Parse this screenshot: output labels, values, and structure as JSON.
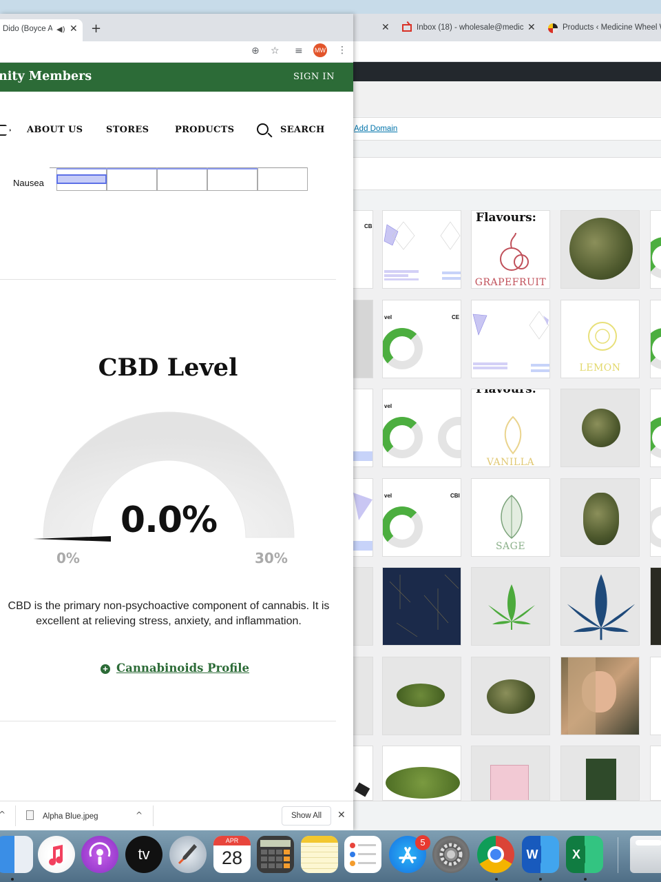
{
  "front_window": {
    "tab": {
      "title": "Dido (Boyce A",
      "speaker_glyph": "◀)",
      "close_glyph": "✕"
    },
    "new_tab_glyph": "+",
    "toolbar": {
      "add_glyph": "⊕",
      "star_glyph": "☆",
      "media_glyph": "≡",
      "avatar_initials": "MW",
      "menu_glyph": "⋮"
    },
    "site": {
      "header_title": "nity Members",
      "sign_in": "SIGN IN",
      "nav": [
        "ABOUT US",
        "STORES",
        "PRODUCTS",
        "SEARCH"
      ]
    },
    "effects": {
      "label": "Nausea",
      "value_fraction": 0.2
    },
    "cbd": {
      "title": "CBD Level",
      "value": "0.0%",
      "min_label": "0%",
      "max_label": "30%",
      "description": "CBD is the primary non-psychoactive component of cannabis. It is excellent at relieving stress, anxiety, and inflammation.",
      "profile_link": "Cannabinoids Profile",
      "colors": {
        "gauge_track": "#e6e6e6",
        "brand_green": "#2c6b37"
      }
    },
    "downloads": {
      "file_name": "Alpha Blue.jpeg",
      "show_all": "Show All",
      "close_glyph": "✕",
      "chevron_glyph": "^"
    }
  },
  "back_window": {
    "tabs": [
      "Inbox (18) - wholesale@medic",
      "Products ‹ Medicine Wheel W"
    ],
    "close_glyph": "✕",
    "add_domain": "Add Domain",
    "media_thumbs": {
      "flavour_heading": "Flavours:",
      "flavour_names": [
        "GRAPEFRUIT",
        "LEMON",
        "VANILLA",
        "SAGE"
      ]
    }
  },
  "dock": {
    "apps": [
      "finder-icon",
      "music-icon",
      "podcasts-icon",
      "apple-tv-icon",
      "launchpad-icon",
      "calendar-icon",
      "calculator-icon",
      "notes-icon",
      "reminders-icon",
      "app-store-icon",
      "system-preferences-icon",
      "chrome-icon",
      "word-icon",
      "excel-icon",
      "trash-icon"
    ],
    "appletv_label": "tv",
    "calendar": {
      "month": "APR",
      "day": "28"
    },
    "app_store_badge": "5",
    "word_letter": "W",
    "excel_letter": "X"
  }
}
